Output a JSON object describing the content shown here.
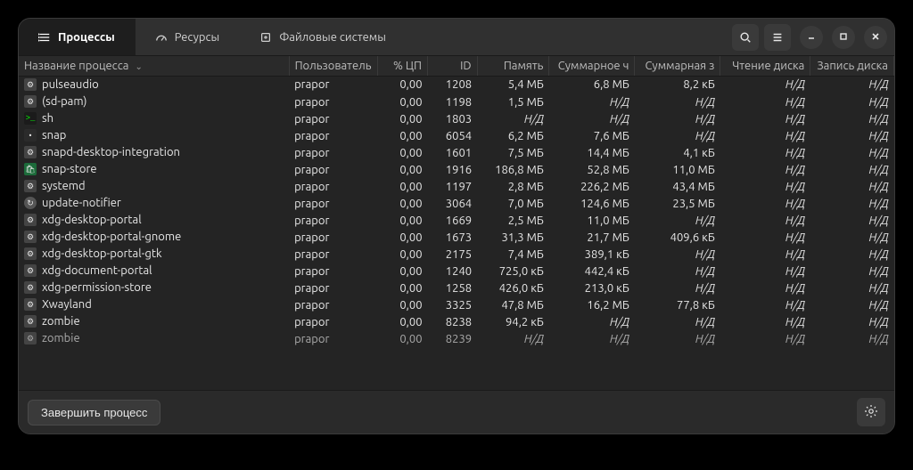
{
  "tabs": {
    "processes": "Процессы",
    "resources": "Ресурсы",
    "filesystems": "Файловые системы"
  },
  "columns": {
    "name": "Название процесса",
    "user": "Пользователь",
    "cpu": "% ЦП",
    "id": "ID",
    "mem": "Память",
    "total_read": "Суммарное ч",
    "total_write": "Суммарная з",
    "disk_read": "Чтение диска",
    "disk_write": "Запись диска"
  },
  "footer": {
    "end_process": "Завершить процесс"
  },
  "na": "Н/Д",
  "rows": [
    {
      "icon": "gear",
      "name": "pulseaudio",
      "user": "prapor",
      "cpu": "0,00",
      "id": "1208",
      "mem": "5,4 МБ",
      "t1": "6,8 МБ",
      "t2": "8,2 кБ",
      "rd": "Н/Д",
      "wd": "Н/Д"
    },
    {
      "icon": "gear",
      "name": "(sd-pam)",
      "user": "prapor",
      "cpu": "0,00",
      "id": "1198",
      "mem": "1,5 МБ",
      "t1": "Н/Д",
      "t2": "Н/Д",
      "rd": "Н/Д",
      "wd": "Н/Д"
    },
    {
      "icon": "term",
      "name": "sh",
      "user": "prapor",
      "cpu": "0,00",
      "id": "1803",
      "mem": "Н/Д",
      "t1": "Н/Д",
      "t2": "Н/Д",
      "rd": "Н/Д",
      "wd": "Н/Д"
    },
    {
      "icon": "snap",
      "name": "snap",
      "user": "prapor",
      "cpu": "0,00",
      "id": "6054",
      "mem": "6,2 МБ",
      "t1": "7,6 МБ",
      "t2": "Н/Д",
      "rd": "Н/Д",
      "wd": "Н/Д"
    },
    {
      "icon": "gear",
      "name": "snapd-desktop-integration",
      "user": "prapor",
      "cpu": "0,00",
      "id": "1601",
      "mem": "7,5 МБ",
      "t1": "14,4 МБ",
      "t2": "4,1 кБ",
      "rd": "Н/Д",
      "wd": "Н/Д"
    },
    {
      "icon": "store",
      "name": "snap-store",
      "user": "prapor",
      "cpu": "0,00",
      "id": "1916",
      "mem": "186,8 МБ",
      "t1": "52,8 МБ",
      "t2": "11,0 МБ",
      "rd": "Н/Д",
      "wd": "Н/Д"
    },
    {
      "icon": "gear",
      "name": "systemd",
      "user": "prapor",
      "cpu": "0,00",
      "id": "1197",
      "mem": "2,8 МБ",
      "t1": "226,2 МБ",
      "t2": "43,4 МБ",
      "rd": "Н/Д",
      "wd": "Н/Д"
    },
    {
      "icon": "upd",
      "name": "update-notifier",
      "user": "prapor",
      "cpu": "0,00",
      "id": "3064",
      "mem": "7,0 МБ",
      "t1": "124,6 МБ",
      "t2": "23,5 МБ",
      "rd": "Н/Д",
      "wd": "Н/Д"
    },
    {
      "icon": "gear",
      "name": "xdg-desktop-portal",
      "user": "prapor",
      "cpu": "0,00",
      "id": "1669",
      "mem": "2,5 МБ",
      "t1": "11,0 МБ",
      "t2": "Н/Д",
      "rd": "Н/Д",
      "wd": "Н/Д"
    },
    {
      "icon": "gear",
      "name": "xdg-desktop-portal-gnome",
      "user": "prapor",
      "cpu": "0,00",
      "id": "1673",
      "mem": "31,3 МБ",
      "t1": "21,7 МБ",
      "t2": "409,6 кБ",
      "rd": "Н/Д",
      "wd": "Н/Д"
    },
    {
      "icon": "gear",
      "name": "xdg-desktop-portal-gtk",
      "user": "prapor",
      "cpu": "0,00",
      "id": "2175",
      "mem": "7,4 МБ",
      "t1": "389,1 кБ",
      "t2": "Н/Д",
      "rd": "Н/Д",
      "wd": "Н/Д"
    },
    {
      "icon": "gear",
      "name": "xdg-document-portal",
      "user": "prapor",
      "cpu": "0,00",
      "id": "1240",
      "mem": "725,0 кБ",
      "t1": "442,4 кБ",
      "t2": "Н/Д",
      "rd": "Н/Д",
      "wd": "Н/Д"
    },
    {
      "icon": "gear",
      "name": "xdg-permission-store",
      "user": "prapor",
      "cpu": "0,00",
      "id": "1258",
      "mem": "426,0 кБ",
      "t1": "213,0 кБ",
      "t2": "Н/Д",
      "rd": "Н/Д",
      "wd": "Н/Д"
    },
    {
      "icon": "gear",
      "name": "Xwayland",
      "user": "prapor",
      "cpu": "0,00",
      "id": "3325",
      "mem": "47,8 МБ",
      "t1": "16,2 МБ",
      "t2": "77,8 кБ",
      "rd": "Н/Д",
      "wd": "Н/Д"
    },
    {
      "icon": "gear",
      "name": "zombie",
      "user": "prapor",
      "cpu": "0,00",
      "id": "8238",
      "mem": "94,2 кБ",
      "t1": "Н/Д",
      "t2": "Н/Д",
      "rd": "Н/Д",
      "wd": "Н/Д"
    },
    {
      "icon": "gear",
      "name": "zombie",
      "user": "prapor",
      "cpu": "0,00",
      "id": "8239",
      "mem": "Н/Д",
      "t1": "Н/Д",
      "t2": "Н/Д",
      "rd": "Н/Д",
      "wd": "Н/Д"
    }
  ]
}
